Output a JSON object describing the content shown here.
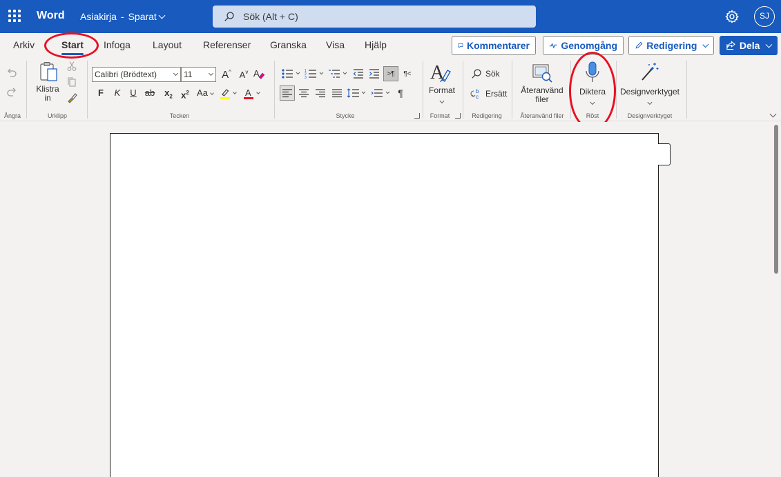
{
  "titlebar": {
    "app_name": "Word",
    "doc_name": "Asiakirja",
    "separator": "-",
    "save_status": "Sparat",
    "search_placeholder": "Sök (Alt + C)",
    "avatar_initials": "SJ",
    "accent_color": "#185abd"
  },
  "tabs": [
    {
      "label": "Arkiv"
    },
    {
      "label": "Start",
      "active": true
    },
    {
      "label": "Infoga"
    },
    {
      "label": "Layout"
    },
    {
      "label": "Referenser"
    },
    {
      "label": "Granska"
    },
    {
      "label": "Visa"
    },
    {
      "label": "Hjälp"
    }
  ],
  "actions": {
    "comments": "Kommentarer",
    "catchup": "Genomgång",
    "editing": "Redigering",
    "share": "Dela"
  },
  "ribbon": {
    "undo_group": {
      "label": "Ångra"
    },
    "clipboard": {
      "label": "Urklipp",
      "paste_line1": "Klistra",
      "paste_line2": "in"
    },
    "font": {
      "label": "Tecken",
      "font_name": "Calibri (Brödtext)",
      "font_size": "11",
      "bold": "F",
      "italic": "K",
      "underline": "U",
      "strike": "ab",
      "subscript_base": "x",
      "subscript": "2",
      "superscript_base": "x",
      "superscript": "2",
      "change_case": "Aa",
      "grow": "A",
      "shrink": "A",
      "font_color_letter": "A",
      "highlight_color": "#ffff00",
      "font_color": "#e81123"
    },
    "paragraph": {
      "label": "Stycke",
      "pilcrow": "¶"
    },
    "styles": {
      "label": "Format",
      "button": "Format"
    },
    "editing": {
      "label": "Redigering",
      "find": "Sök",
      "replace": "Ersätt"
    },
    "reuse": {
      "label": "Återanvänd filer",
      "line1": "Återanvänd",
      "line2": "filer"
    },
    "voice": {
      "label": "Röst",
      "dictate": "Diktera"
    },
    "designer": {
      "label": "Designverktyget",
      "button": "Designverktyget"
    }
  }
}
